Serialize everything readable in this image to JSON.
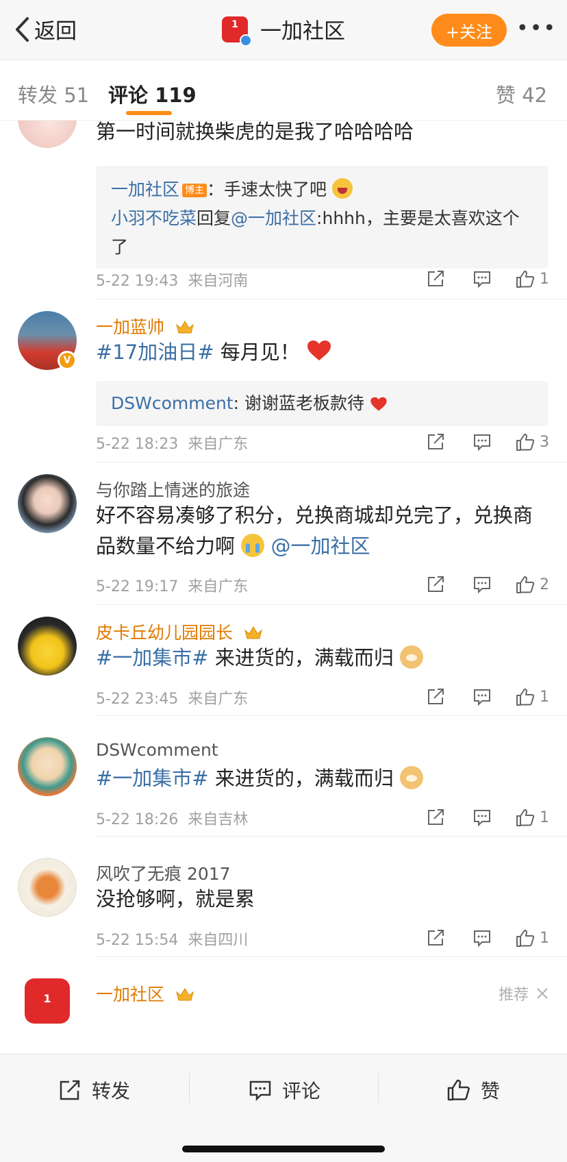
{
  "nav": {
    "back_label": "返回",
    "title": "一加社区",
    "logo_text": "1",
    "follow_label": "+关注",
    "more_label": "•••"
  },
  "tabs": [
    {
      "label": "转发 51"
    },
    {
      "label": "评论 119"
    },
    {
      "label": "赞 42"
    }
  ],
  "comments": [
    {
      "text": "第一时间就换柴虎的是我了哈哈哈哈",
      "reply": {
        "line1_name": "一加社区",
        "line1_badge": "博主",
        "line1_text": "：手速太快了吧",
        "line2_name": "小羽不吃菜",
        "line2_mid": "回复",
        "line2_at": "@一加社区",
        "line2_text": ":hhhh，主要是太喜欢这个了"
      },
      "time": "5-22 19:43",
      "source": "来自河南",
      "likes": "1"
    },
    {
      "name": "一加蓝帅",
      "tag": "#17加油日#",
      "text": " 每月见！",
      "reply": {
        "name": "DSWcomment",
        "text": ": 谢谢蓝老板款待"
      },
      "time": "5-22 18:23",
      "source": "来自广东",
      "likes": "3",
      "badge": "V"
    },
    {
      "name": "与你踏上情迷的旅途",
      "text": "好不容易凑够了积分，兑换商城却兑完了，兑换商品数量不给力啊",
      "at": "@一加社区",
      "time": "5-22 19:17",
      "source": "来自广东",
      "likes": "2"
    },
    {
      "name": "皮卡丘幼儿园园长",
      "tag": "#一加集市#",
      "text": " 来进货的，满载而归",
      "time": "5-22 23:45",
      "source": "来自广东",
      "likes": "1"
    },
    {
      "name": "DSWcomment",
      "tag": "#一加集市#",
      "text": " 来进货的，满载而归",
      "time": "5-22 18:26",
      "source": "来自吉林",
      "likes": "1"
    },
    {
      "name": "风吹了无痕 2017",
      "text": "没抢够啊，就是累",
      "time": "5-22 15:54",
      "source": "来自四川",
      "likes": "1"
    },
    {
      "name": "一加社区",
      "recommend": "推荐",
      "logo_text": "1"
    }
  ],
  "bottom": {
    "repost": "转发",
    "comment": "评论",
    "like": "赞"
  },
  "colors": {
    "accent": "#ff8c1a",
    "link": "#3b6fa6",
    "gold_name": "#e07b00"
  }
}
